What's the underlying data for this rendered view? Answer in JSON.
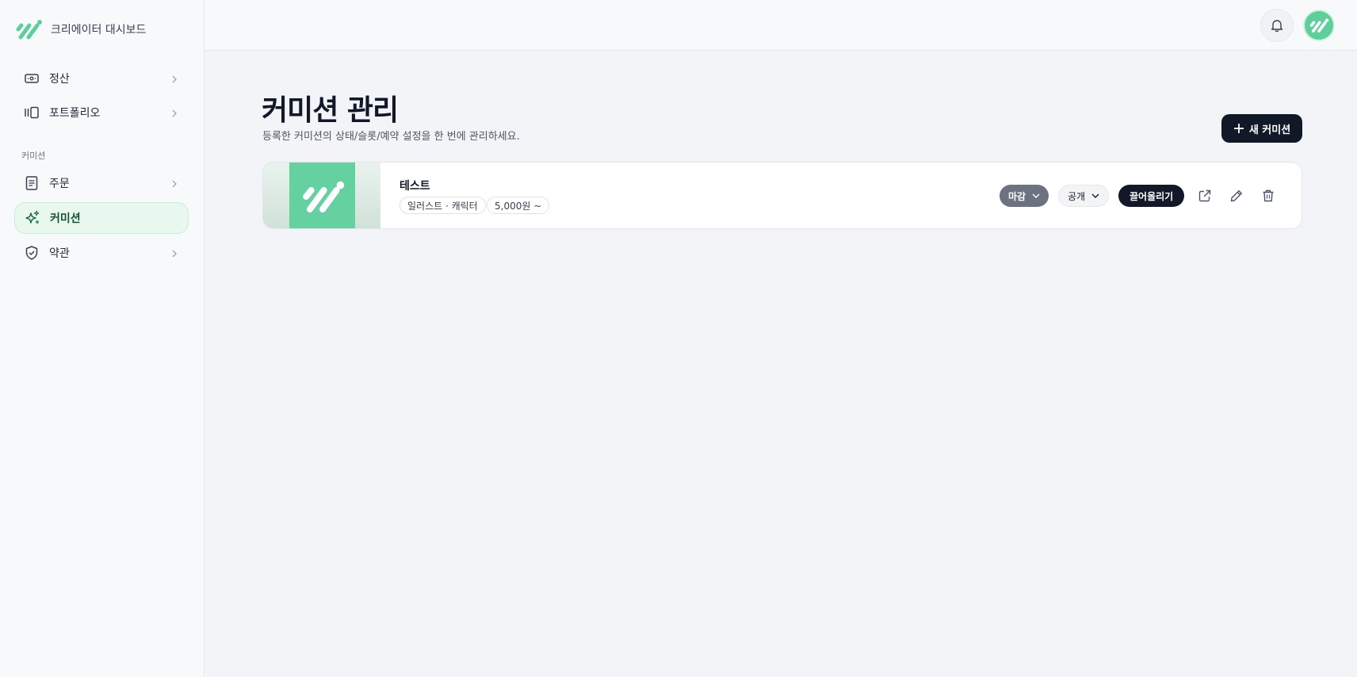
{
  "brand": {
    "name": "크리에이터 대시보드",
    "logo_icon": "slash-dots-logo",
    "accent": "#5ecf9a"
  },
  "sidebar": {
    "items_top": [
      {
        "label": "정산",
        "icon": "wallet-icon"
      },
      {
        "label": "포트폴리오",
        "icon": "portfolio-icon"
      }
    ],
    "section_label": "커미션",
    "items_section": [
      {
        "label": "주문",
        "icon": "document-icon"
      },
      {
        "label": "커미션",
        "icon": "sparkles-icon",
        "active": true
      },
      {
        "label": "약관",
        "icon": "shield-icon"
      }
    ]
  },
  "topbar": {
    "bell_icon": "bell-icon",
    "avatar_icon": "avatar-logo"
  },
  "main": {
    "title": "커미션 관리",
    "subtitle": "등록한 커미션의 상태/슬롯/예약 설정을 한 번에 관리하세요.",
    "new_button": "새 커미션"
  },
  "commissions": [
    {
      "title": "테스트",
      "tags": [
        "일러스트 · 캐릭터",
        "5,000원 ~"
      ],
      "status": "마감",
      "visibility": "공개",
      "bump_label": "끌어올리기"
    }
  ],
  "colors": {
    "dark": "#111827",
    "status_closed": "#6b7280",
    "active_bg": "#e8f8ee"
  }
}
